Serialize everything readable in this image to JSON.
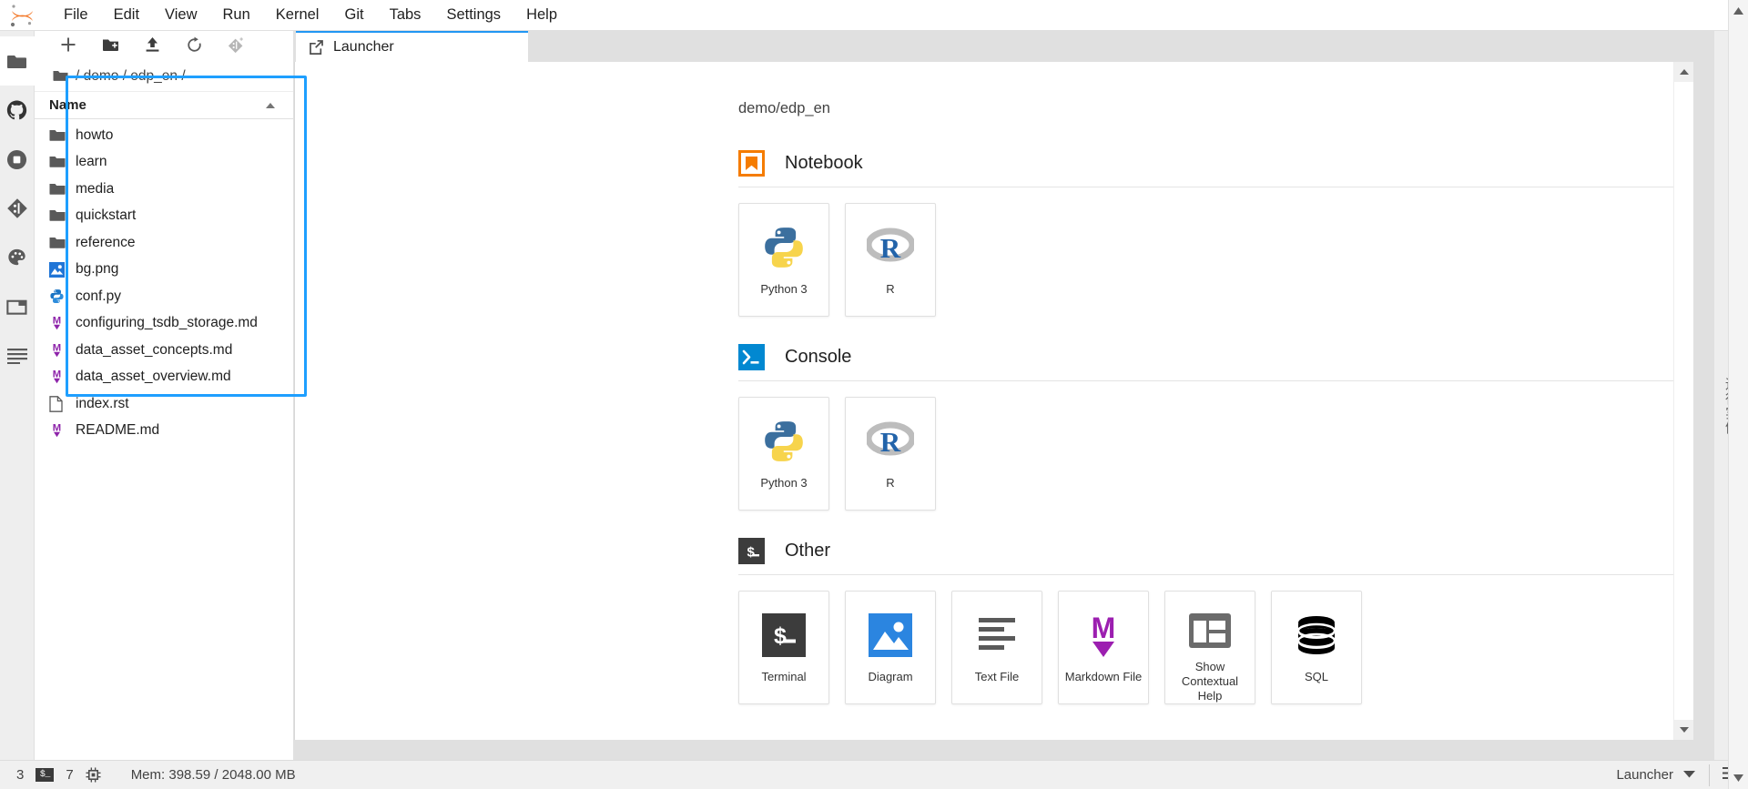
{
  "menubar": {
    "logo_name": "jupyter-logo",
    "items": [
      "File",
      "Edit",
      "View",
      "Run",
      "Kernel",
      "Git",
      "Tabs",
      "Settings",
      "Help"
    ]
  },
  "activitybar": {
    "items": [
      {
        "name": "file-browser-icon",
        "label": "File Browser",
        "active": true
      },
      {
        "name": "github-icon",
        "label": "GitHub",
        "active": false
      },
      {
        "name": "running-terminals-icon",
        "label": "Running Terminals and Kernels",
        "active": false
      },
      {
        "name": "git-icon",
        "label": "Git",
        "active": false
      },
      {
        "name": "palette-icon",
        "label": "Theme / Extensions",
        "active": false
      },
      {
        "name": "window-icon",
        "label": "Open Tabs",
        "active": false
      },
      {
        "name": "toc-icon",
        "label": "Table of Contents",
        "active": false
      }
    ]
  },
  "filebrowser": {
    "toolbar": [
      {
        "name": "new-launcher-icon",
        "label": "New Launcher"
      },
      {
        "name": "new-folder-icon",
        "label": "New Folder"
      },
      {
        "name": "upload-icon",
        "label": "Upload Files"
      },
      {
        "name": "refresh-icon",
        "label": "Refresh File List"
      },
      {
        "name": "git-clone-icon",
        "label": "Git Clone"
      }
    ],
    "breadcrumb": "/ demo / edp_en /",
    "column_header": "Name",
    "items": [
      {
        "name": "howto",
        "type": "folder"
      },
      {
        "name": "learn",
        "type": "folder"
      },
      {
        "name": "media",
        "type": "folder"
      },
      {
        "name": "quickstart",
        "type": "folder"
      },
      {
        "name": "reference",
        "type": "folder"
      },
      {
        "name": "bg.png",
        "type": "image"
      },
      {
        "name": "conf.py",
        "type": "python"
      },
      {
        "name": "configuring_tsdb_storage.md",
        "type": "markdown"
      },
      {
        "name": "data_asset_concepts.md",
        "type": "markdown"
      },
      {
        "name": "data_asset_overview.md",
        "type": "markdown"
      },
      {
        "name": "index.rst",
        "type": "text"
      },
      {
        "name": "README.md",
        "type": "markdown"
      }
    ]
  },
  "dock": {
    "tabs": [
      {
        "label": "Launcher",
        "icon": "launcher-icon",
        "active": true
      }
    ]
  },
  "launcher": {
    "path": "demo/edp_en",
    "sections": [
      {
        "title": "Notebook",
        "icon": "notebook-icon",
        "cards": [
          {
            "label": "Python 3",
            "icon": "python-icon"
          },
          {
            "label": "R",
            "icon": "r-icon"
          }
        ]
      },
      {
        "title": "Console",
        "icon": "console-icon",
        "cards": [
          {
            "label": "Python 3",
            "icon": "python-icon"
          },
          {
            "label": "R",
            "icon": "r-icon"
          }
        ]
      },
      {
        "title": "Other",
        "icon": "other-icon",
        "cards": [
          {
            "label": "Terminal",
            "icon": "terminal-icon"
          },
          {
            "label": "Diagram",
            "icon": "diagram-icon"
          },
          {
            "label": "Text File",
            "icon": "text-file-icon"
          },
          {
            "label": "Markdown File",
            "icon": "markdown-icon"
          },
          {
            "label": "Show Contextual Help",
            "icon": "contextual-help-icon"
          },
          {
            "label": "SQL",
            "icon": "sql-icon"
          }
        ]
      }
    ]
  },
  "right_rail": {
    "label": "运行实例"
  },
  "statusbar": {
    "kernel_count": "3",
    "terminal_icon": "$_",
    "terminal_count": "7",
    "cpu_icon_name": "cpu-icon",
    "memory": "Mem: 398.59 / 2048.00 MB",
    "active_tab": "Launcher",
    "toc_icon_name": "toc-icon"
  }
}
